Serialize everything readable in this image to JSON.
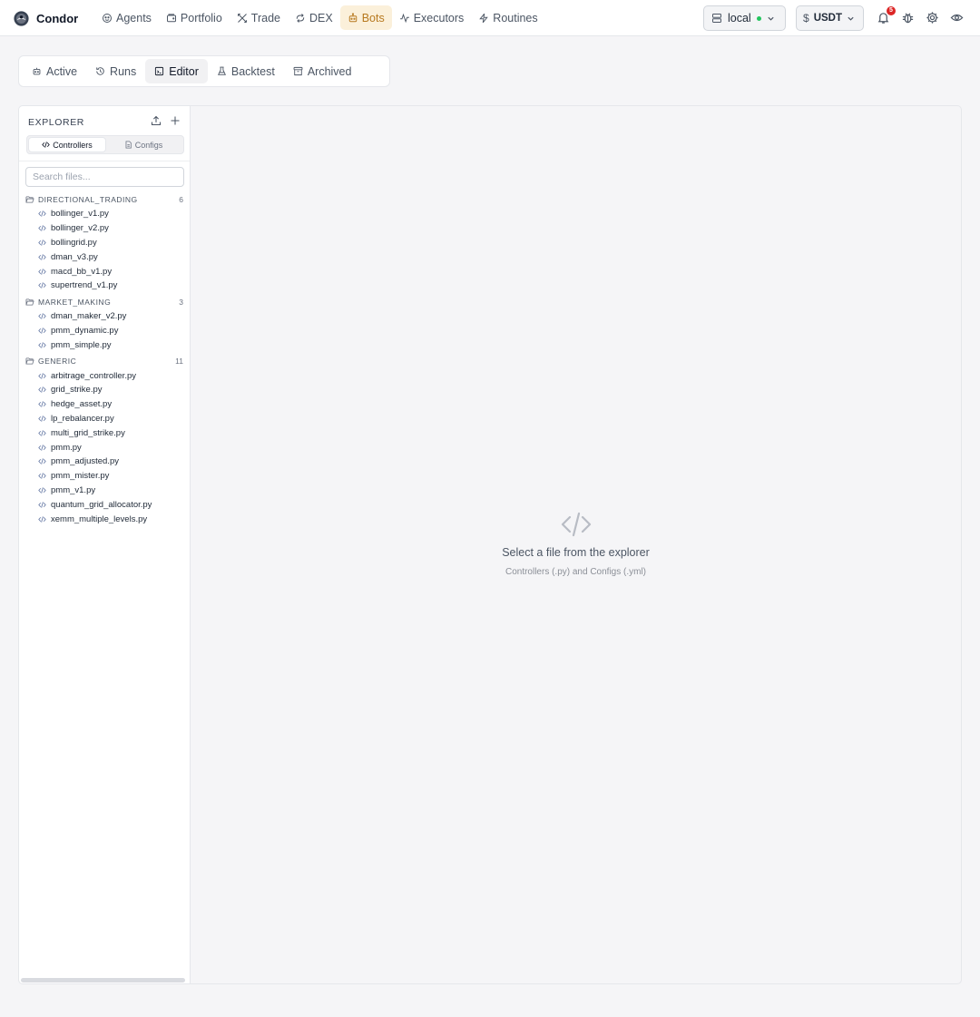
{
  "app": {
    "name": "Condor"
  },
  "nav": {
    "items": [
      {
        "label": "Agents",
        "icon": "bot-face-icon",
        "active": false
      },
      {
        "label": "Portfolio",
        "icon": "wallet-icon",
        "active": false
      },
      {
        "label": "Trade",
        "icon": "arrows-cross-icon",
        "active": false
      },
      {
        "label": "DEX",
        "icon": "swap-icon",
        "active": false
      },
      {
        "label": "Bots",
        "icon": "bot-icon",
        "active": true
      },
      {
        "label": "Executors",
        "icon": "activity-icon",
        "active": false
      },
      {
        "label": "Routines",
        "icon": "lightning-icon",
        "active": false
      }
    ]
  },
  "header": {
    "server": "local",
    "server_status_color": "#22c55e",
    "currency": "USDT",
    "notification_count": "5"
  },
  "tabs": [
    {
      "label": "Active",
      "active": false
    },
    {
      "label": "Runs",
      "active": false
    },
    {
      "label": "Editor",
      "active": true
    },
    {
      "label": "Backtest",
      "active": false
    },
    {
      "label": "Archived",
      "active": false
    }
  ],
  "explorer": {
    "title": "EXPLORER",
    "segments": [
      "Controllers",
      "Configs"
    ],
    "active_segment": "Controllers",
    "search_placeholder": "Search files...",
    "folders": [
      {
        "name": "DIRECTIONAL_TRADING",
        "count": "6",
        "files": [
          "bollinger_v1.py",
          "bollinger_v2.py",
          "bollingrid.py",
          "dman_v3.py",
          "macd_bb_v1.py",
          "supertrend_v1.py"
        ]
      },
      {
        "name": "MARKET_MAKING",
        "count": "3",
        "files": [
          "dman_maker_v2.py",
          "pmm_dynamic.py",
          "pmm_simple.py"
        ]
      },
      {
        "name": "GENERIC",
        "count": "11",
        "files": [
          "arbitrage_controller.py",
          "grid_strike.py",
          "hedge_asset.py",
          "lp_rebalancer.py",
          "multi_grid_strike.py",
          "pmm.py",
          "pmm_adjusted.py",
          "pmm_mister.py",
          "pmm_v1.py",
          "quantum_grid_allocator.py",
          "xemm_multiple_levels.py"
        ]
      }
    ]
  },
  "editor": {
    "empty_title": "Select a file from the explorer",
    "empty_subtitle": "Controllers (.py) and Configs (.yml)"
  },
  "colors": {
    "accent": "#b7791f",
    "accent_bg": "#fbf0da",
    "badge": "#dc2626"
  }
}
